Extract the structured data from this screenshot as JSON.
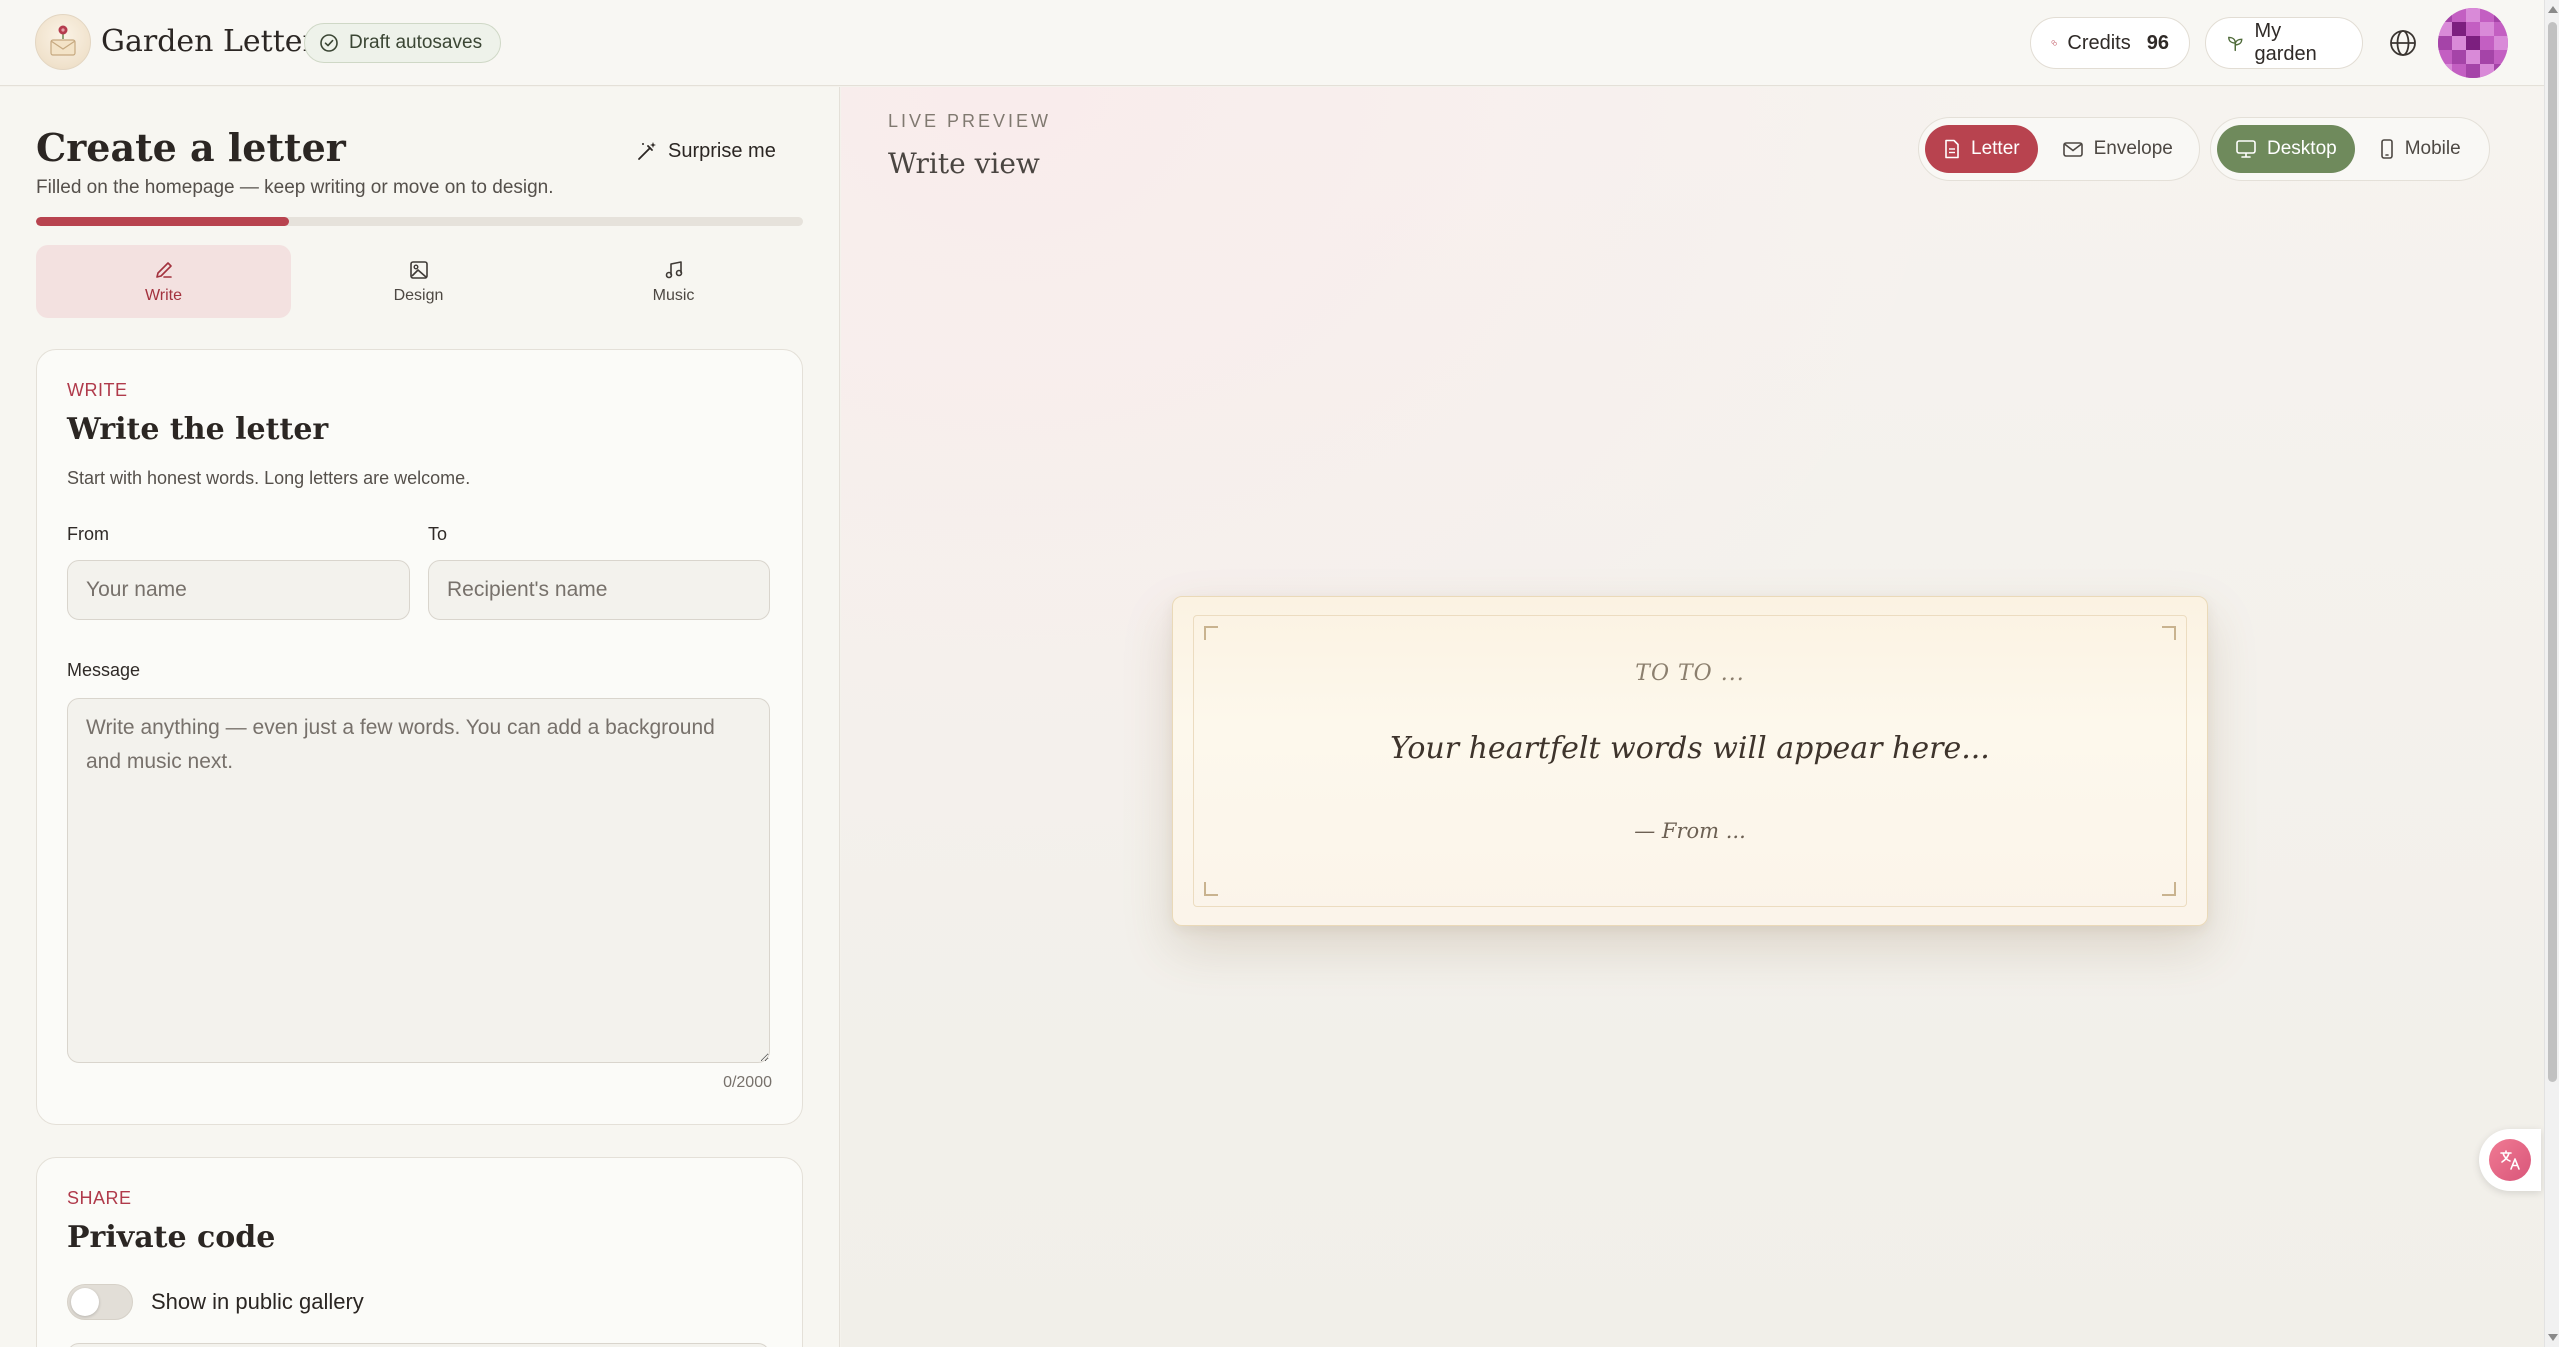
{
  "header": {
    "brand": "Garden Letters",
    "draft_badge": "Draft autosaves",
    "credits_label": "Credits",
    "credits_value": "96",
    "garden_label": "My garden"
  },
  "create": {
    "title": "Create a letter",
    "subtitle": "Filled on the homepage — keep writing or move on to design.",
    "surprise_label": "Surprise me",
    "progress_percent": 33
  },
  "tabs": [
    {
      "label": "Write",
      "icon": "pencil-icon",
      "active": true
    },
    {
      "label": "Design",
      "icon": "image-icon",
      "active": false
    },
    {
      "label": "Music",
      "icon": "music-note-icon",
      "active": false
    }
  ],
  "write_card": {
    "eyebrow": "WRITE",
    "title": "Write the letter",
    "description": "Start with honest words. Long letters are welcome.",
    "from_label": "From",
    "from_placeholder": "Your name",
    "to_label": "To",
    "to_placeholder": "Recipient's name",
    "message_label": "Message",
    "message_placeholder": "Write anything — even just a few words. You can add a background and music next.",
    "counter": "0/2000"
  },
  "share_card": {
    "eyebrow": "SHARE",
    "title": "Private code",
    "toggle_label": "Show in public gallery"
  },
  "preview": {
    "live_label": "LIVE PREVIEW",
    "view_title": "Write view",
    "view_options": [
      "Letter",
      "Envelope"
    ],
    "device_options": [
      "Desktop",
      "Mobile"
    ],
    "letter_to": "TO TO ...",
    "letter_body": "Your heartfelt words will appear here...",
    "letter_from": "— From ..."
  },
  "colors": {
    "accent_red": "#b8434f",
    "accent_green": "#6f8a5c"
  }
}
